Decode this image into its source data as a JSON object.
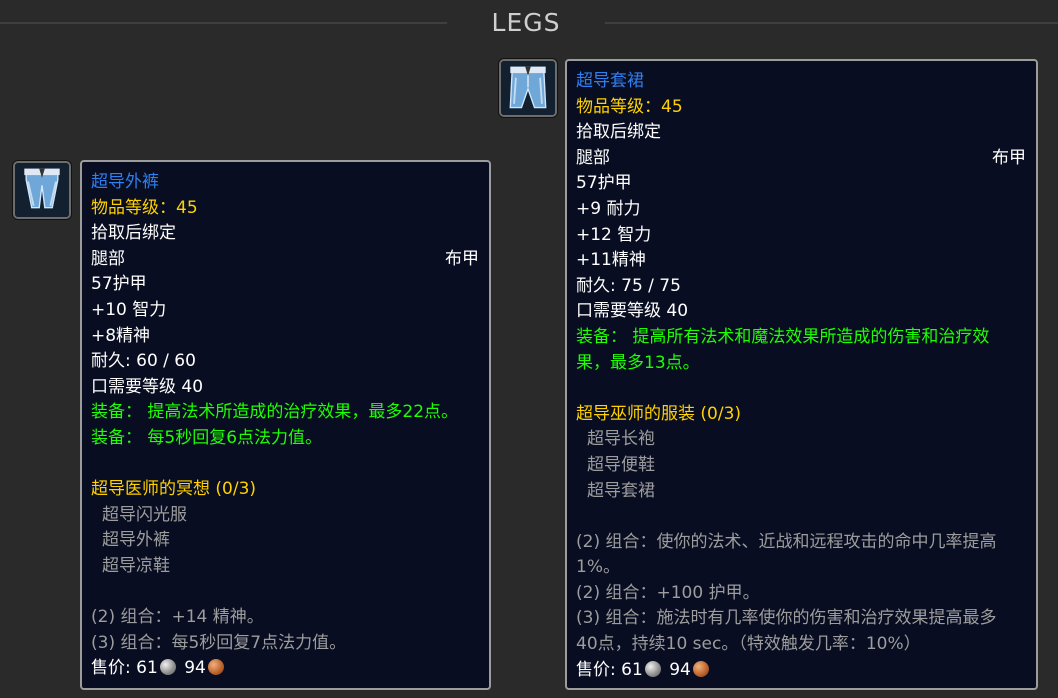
{
  "section": {
    "title": "LEGS"
  },
  "items": [
    {
      "icon": "cloth-leggings-icon",
      "name": "超导外裤",
      "item_level": "物品等级：45",
      "binding": "拾取后绑定",
      "slot": "腿部",
      "type": "布甲",
      "stats": [
        "57护甲",
        "+10 智力",
        "+8精神"
      ],
      "durability": "耐久: 60 / 60",
      "requirement": "口需要等级 40",
      "effects": [
        "装备： 提高法术所造成的治疗效果，最多22点。",
        "装备： 每5秒回复6点法力值。"
      ],
      "set_name": "超导医师的冥想 (0/3)",
      "set_items": [
        "超导闪光服",
        "超导外裤",
        "超导凉鞋"
      ],
      "set_bonuses": [
        "(2) 组合：+14 精神。",
        "(3) 组合：每5秒回复7点法力值。"
      ],
      "sell_label": "售价:",
      "sell_silver": "61",
      "sell_copper": "94"
    },
    {
      "icon": "cloth-skirt-icon",
      "name": "超导套裙",
      "item_level": "物品等级：45",
      "binding": "拾取后绑定",
      "slot": "腿部",
      "type": "布甲",
      "stats": [
        "57护甲",
        "+9 耐力",
        "+12 智力",
        "+11精神"
      ],
      "durability": "耐久: 75 / 75",
      "requirement": "口需要等级 40",
      "effects": [
        "装备： 提高所有法术和魔法效果所造成的伤害和治疗效",
        "果，最多13点。"
      ],
      "set_name": "超导巫师的服装 (0/3)",
      "set_items": [
        "超导长袍",
        "超导便鞋",
        "超导套裙"
      ],
      "set_bonuses": [
        "(2) 组合：使你的法术、近战和远程攻击的命中几率提高",
        "1%。",
        "(2) 组合：+100 护甲。",
        "(3) 组合：施法时有几率使你的伤害和治疗效果提高最多",
        "40点，持续10 sec。（特效触发几率：10%）"
      ],
      "sell_label": "售价:",
      "sell_silver": "61",
      "sell_copper": "94"
    }
  ]
}
